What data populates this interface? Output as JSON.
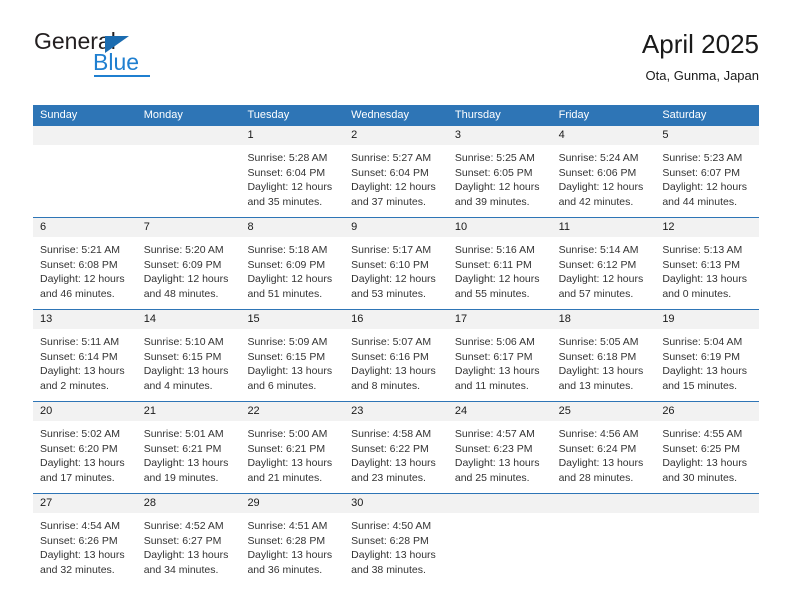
{
  "brand": {
    "name_top": "General",
    "name_bottom": "Blue",
    "accent_color": "#1f7fd0",
    "logo_icon": "triangle-icon"
  },
  "header": {
    "title": "April 2025",
    "subtitle": "Ota, Gunma, Japan"
  },
  "calendar": {
    "header_bg": "#2e75b6",
    "date_band_bg": "#f2f2f2",
    "weekdays": [
      "Sunday",
      "Monday",
      "Tuesday",
      "Wednesday",
      "Thursday",
      "Friday",
      "Saturday"
    ],
    "weeks": [
      [
        {
          "date": "",
          "lines": []
        },
        {
          "date": "",
          "lines": []
        },
        {
          "date": "1",
          "lines": [
            "Sunrise: 5:28 AM",
            "Sunset: 6:04 PM",
            "Daylight: 12 hours",
            "and 35 minutes."
          ]
        },
        {
          "date": "2",
          "lines": [
            "Sunrise: 5:27 AM",
            "Sunset: 6:04 PM",
            "Daylight: 12 hours",
            "and 37 minutes."
          ]
        },
        {
          "date": "3",
          "lines": [
            "Sunrise: 5:25 AM",
            "Sunset: 6:05 PM",
            "Daylight: 12 hours",
            "and 39 minutes."
          ]
        },
        {
          "date": "4",
          "lines": [
            "Sunrise: 5:24 AM",
            "Sunset: 6:06 PM",
            "Daylight: 12 hours",
            "and 42 minutes."
          ]
        },
        {
          "date": "5",
          "lines": [
            "Sunrise: 5:23 AM",
            "Sunset: 6:07 PM",
            "Daylight: 12 hours",
            "and 44 minutes."
          ]
        }
      ],
      [
        {
          "date": "6",
          "lines": [
            "Sunrise: 5:21 AM",
            "Sunset: 6:08 PM",
            "Daylight: 12 hours",
            "and 46 minutes."
          ]
        },
        {
          "date": "7",
          "lines": [
            "Sunrise: 5:20 AM",
            "Sunset: 6:09 PM",
            "Daylight: 12 hours",
            "and 48 minutes."
          ]
        },
        {
          "date": "8",
          "lines": [
            "Sunrise: 5:18 AM",
            "Sunset: 6:09 PM",
            "Daylight: 12 hours",
            "and 51 minutes."
          ]
        },
        {
          "date": "9",
          "lines": [
            "Sunrise: 5:17 AM",
            "Sunset: 6:10 PM",
            "Daylight: 12 hours",
            "and 53 minutes."
          ]
        },
        {
          "date": "10",
          "lines": [
            "Sunrise: 5:16 AM",
            "Sunset: 6:11 PM",
            "Daylight: 12 hours",
            "and 55 minutes."
          ]
        },
        {
          "date": "11",
          "lines": [
            "Sunrise: 5:14 AM",
            "Sunset: 6:12 PM",
            "Daylight: 12 hours",
            "and 57 minutes."
          ]
        },
        {
          "date": "12",
          "lines": [
            "Sunrise: 5:13 AM",
            "Sunset: 6:13 PM",
            "Daylight: 13 hours",
            "and 0 minutes."
          ]
        }
      ],
      [
        {
          "date": "13",
          "lines": [
            "Sunrise: 5:11 AM",
            "Sunset: 6:14 PM",
            "Daylight: 13 hours",
            "and 2 minutes."
          ]
        },
        {
          "date": "14",
          "lines": [
            "Sunrise: 5:10 AM",
            "Sunset: 6:15 PM",
            "Daylight: 13 hours",
            "and 4 minutes."
          ]
        },
        {
          "date": "15",
          "lines": [
            "Sunrise: 5:09 AM",
            "Sunset: 6:15 PM",
            "Daylight: 13 hours",
            "and 6 minutes."
          ]
        },
        {
          "date": "16",
          "lines": [
            "Sunrise: 5:07 AM",
            "Sunset: 6:16 PM",
            "Daylight: 13 hours",
            "and 8 minutes."
          ]
        },
        {
          "date": "17",
          "lines": [
            "Sunrise: 5:06 AM",
            "Sunset: 6:17 PM",
            "Daylight: 13 hours",
            "and 11 minutes."
          ]
        },
        {
          "date": "18",
          "lines": [
            "Sunrise: 5:05 AM",
            "Sunset: 6:18 PM",
            "Daylight: 13 hours",
            "and 13 minutes."
          ]
        },
        {
          "date": "19",
          "lines": [
            "Sunrise: 5:04 AM",
            "Sunset: 6:19 PM",
            "Daylight: 13 hours",
            "and 15 minutes."
          ]
        }
      ],
      [
        {
          "date": "20",
          "lines": [
            "Sunrise: 5:02 AM",
            "Sunset: 6:20 PM",
            "Daylight: 13 hours",
            "and 17 minutes."
          ]
        },
        {
          "date": "21",
          "lines": [
            "Sunrise: 5:01 AM",
            "Sunset: 6:21 PM",
            "Daylight: 13 hours",
            "and 19 minutes."
          ]
        },
        {
          "date": "22",
          "lines": [
            "Sunrise: 5:00 AM",
            "Sunset: 6:21 PM",
            "Daylight: 13 hours",
            "and 21 minutes."
          ]
        },
        {
          "date": "23",
          "lines": [
            "Sunrise: 4:58 AM",
            "Sunset: 6:22 PM",
            "Daylight: 13 hours",
            "and 23 minutes."
          ]
        },
        {
          "date": "24",
          "lines": [
            "Sunrise: 4:57 AM",
            "Sunset: 6:23 PM",
            "Daylight: 13 hours",
            "and 25 minutes."
          ]
        },
        {
          "date": "25",
          "lines": [
            "Sunrise: 4:56 AM",
            "Sunset: 6:24 PM",
            "Daylight: 13 hours",
            "and 28 minutes."
          ]
        },
        {
          "date": "26",
          "lines": [
            "Sunrise: 4:55 AM",
            "Sunset: 6:25 PM",
            "Daylight: 13 hours",
            "and 30 minutes."
          ]
        }
      ],
      [
        {
          "date": "27",
          "lines": [
            "Sunrise: 4:54 AM",
            "Sunset: 6:26 PM",
            "Daylight: 13 hours",
            "and 32 minutes."
          ]
        },
        {
          "date": "28",
          "lines": [
            "Sunrise: 4:52 AM",
            "Sunset: 6:27 PM",
            "Daylight: 13 hours",
            "and 34 minutes."
          ]
        },
        {
          "date": "29",
          "lines": [
            "Sunrise: 4:51 AM",
            "Sunset: 6:28 PM",
            "Daylight: 13 hours",
            "and 36 minutes."
          ]
        },
        {
          "date": "30",
          "lines": [
            "Sunrise: 4:50 AM",
            "Sunset: 6:28 PM",
            "Daylight: 13 hours",
            "and 38 minutes."
          ]
        },
        {
          "date": "",
          "lines": []
        },
        {
          "date": "",
          "lines": []
        },
        {
          "date": "",
          "lines": []
        }
      ]
    ]
  }
}
